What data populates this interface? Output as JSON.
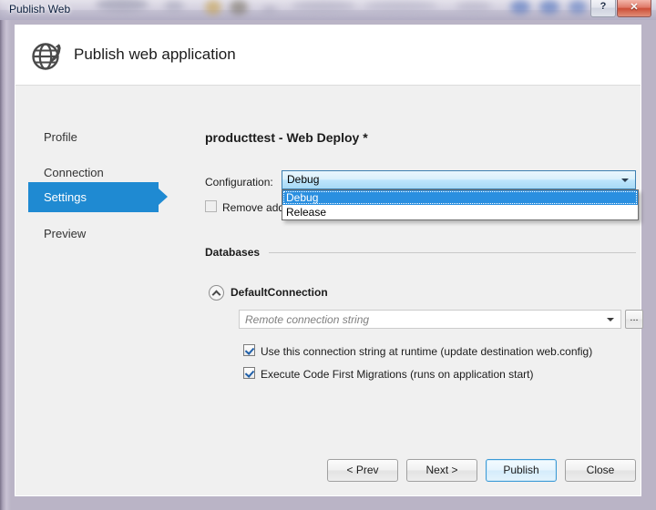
{
  "window": {
    "title": "Publish Web",
    "help_button_glyph": "?",
    "close_button_glyph": "✕"
  },
  "dialog": {
    "header_title": "Publish web application",
    "header_icon": "globe-publish-icon"
  },
  "sidebar": {
    "items": [
      {
        "label": "Profile",
        "selected": false
      },
      {
        "label": "Connection",
        "selected": false
      },
      {
        "label": "Settings",
        "selected": true
      },
      {
        "label": "Preview",
        "selected": false
      }
    ]
  },
  "main": {
    "profile_title": "producttest - Web Deploy *",
    "configuration": {
      "label": "Configuration:",
      "value": "Debug",
      "expanded": true,
      "options": [
        {
          "label": "Debug",
          "highlighted": true
        },
        {
          "label": "Release",
          "highlighted": false
        }
      ]
    },
    "remove_additional_files": {
      "label": "Remove additional files at destination",
      "checked": false
    },
    "databases": {
      "group_label": "Databases",
      "connection_name": "DefaultConnection",
      "expander_icon": "chevron-up-circle-icon",
      "connection_string_placeholder": "Remote connection string",
      "connection_string_value": "",
      "browse_button_label": "...",
      "options": [
        {
          "label": "Use this connection string at runtime (update destination web.config)",
          "checked": true
        },
        {
          "label": "Execute Code First Migrations (runs on application start)",
          "checked": true
        }
      ]
    }
  },
  "footer": {
    "buttons": [
      {
        "label": "< Prev",
        "default": false
      },
      {
        "label": "Next >",
        "default": false
      },
      {
        "label": "Publish",
        "default": true
      },
      {
        "label": "Close",
        "default": false
      }
    ]
  },
  "colors": {
    "accent_blue": "#1f8ad2",
    "highlight_blue": "#2a8fe0",
    "dialog_bg": "#f0f0f0",
    "header_bg": "#ffffff",
    "close_red": "#cc4f38"
  }
}
